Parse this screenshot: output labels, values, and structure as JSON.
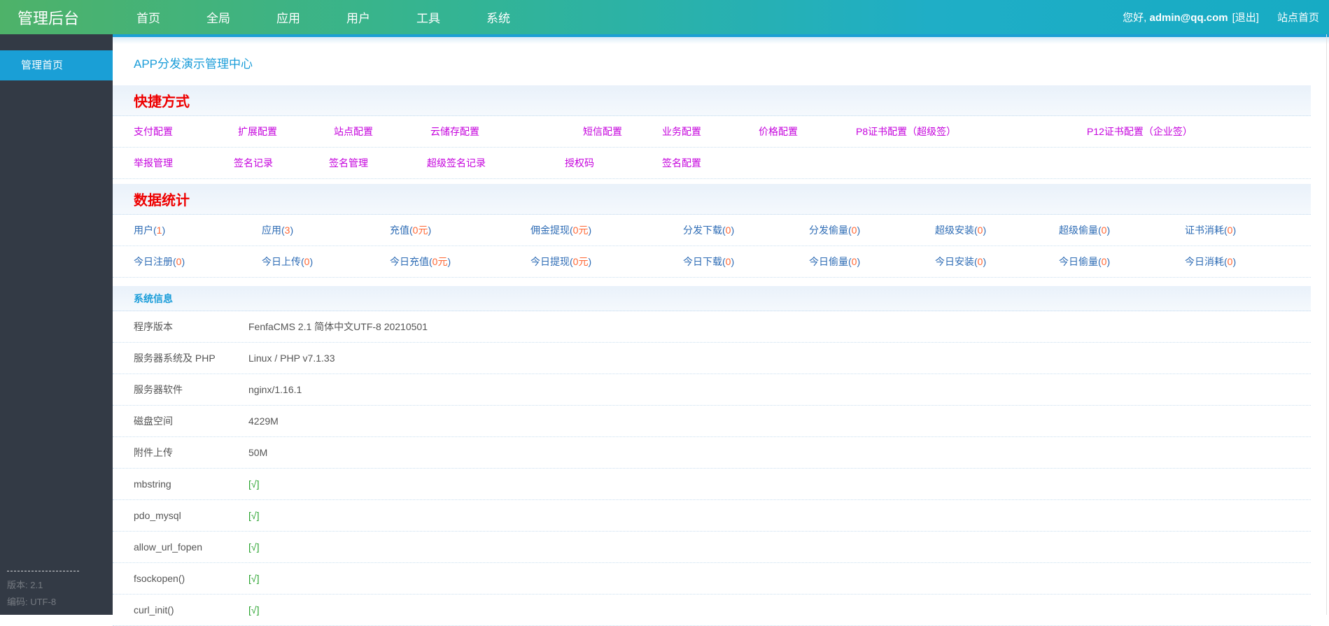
{
  "topbar": {
    "brand": "管理后台",
    "nav": [
      "首页",
      "全局",
      "应用",
      "用户",
      "工具",
      "系统"
    ],
    "greeting_prefix": "您好,",
    "user_email": "admin@qq.com",
    "logout_label": "[退出]",
    "site_home_label": "站点首页"
  },
  "sidebar": {
    "menu": [
      {
        "label": "管理首页",
        "active": true
      }
    ],
    "footer": {
      "version": "版本: 2.1",
      "encoding": "编码: UTF-8"
    }
  },
  "main": {
    "page_title": "APP分发演示管理中心",
    "shortcuts": {
      "heading": "快捷方式",
      "row1": [
        "支付配置",
        "扩展配置",
        "站点配置",
        "云储存配置",
        "短信配置",
        "业务配置",
        "价格配置",
        "P8证书配置（超级签）",
        "P12证书配置（企业签）"
      ],
      "row2": [
        "举报管理",
        "签名记录",
        "签名管理",
        "超级签名记录",
        "授权码",
        "签名配置"
      ]
    },
    "stats": {
      "heading": "数据统计",
      "row1": [
        {
          "label": "用户",
          "value": "1"
        },
        {
          "label": "应用",
          "value": "3"
        },
        {
          "label": "充值",
          "value": "0元"
        },
        {
          "label": "佣金提现",
          "value": "0元"
        },
        {
          "label": "分发下载",
          "value": "0"
        },
        {
          "label": "分发偷量",
          "value": "0"
        },
        {
          "label": "超级安装",
          "value": "0"
        },
        {
          "label": "超级偷量",
          "value": "0"
        },
        {
          "label": "证书消耗",
          "value": "0"
        }
      ],
      "row2": [
        {
          "label": "今日注册",
          "value": "0"
        },
        {
          "label": "今日上传",
          "value": "0"
        },
        {
          "label": "今日充值",
          "value": "0元"
        },
        {
          "label": "今日提现",
          "value": "0元"
        },
        {
          "label": "今日下载",
          "value": "0"
        },
        {
          "label": "今日偷量",
          "value": "0"
        },
        {
          "label": "今日安装",
          "value": "0"
        },
        {
          "label": "今日偷量",
          "value": "0"
        },
        {
          "label": "今日消耗",
          "value": "0"
        }
      ]
    },
    "sysinfo": {
      "heading": "系统信息",
      "rows": [
        {
          "label": "程序版本",
          "value": "FenfaCMS 2.1 简体中文UTF-8 20210501",
          "ok": false
        },
        {
          "label": "服务器系统及 PHP",
          "value": "Linux / PHP v7.1.33",
          "ok": false
        },
        {
          "label": "服务器软件",
          "value": "nginx/1.16.1",
          "ok": false
        },
        {
          "label": "磁盘空间",
          "value": "4229M",
          "ok": false
        },
        {
          "label": "附件上传",
          "value": "50M",
          "ok": false
        },
        {
          "label": "mbstring",
          "value": "[√]",
          "ok": true
        },
        {
          "label": "pdo_mysql",
          "value": "[√]",
          "ok": true
        },
        {
          "label": "allow_url_fopen",
          "value": "[√]",
          "ok": true
        },
        {
          "label": "fsockopen()",
          "value": "[√]",
          "ok": true
        },
        {
          "label": "curl_init()",
          "value": "[√]",
          "ok": true
        }
      ]
    }
  },
  "colors": {
    "topbar_green": "#4eb269",
    "topbar_teal": "#17abc4",
    "topbar_underline": "#1b9fd4",
    "sidebar_bg": "#333a45",
    "sidebar_active": "#1a9fd6",
    "heading_red": "#ee0000",
    "heading_blue": "#1b9dd9",
    "link_magenta": "#c503dd",
    "stat_blue": "#2e6cb5",
    "stat_number_orange": "#ff6633",
    "check_green": "#2aa32f",
    "band_bg": "#e9f1fa",
    "dotted_border": "#c9dff0"
  }
}
